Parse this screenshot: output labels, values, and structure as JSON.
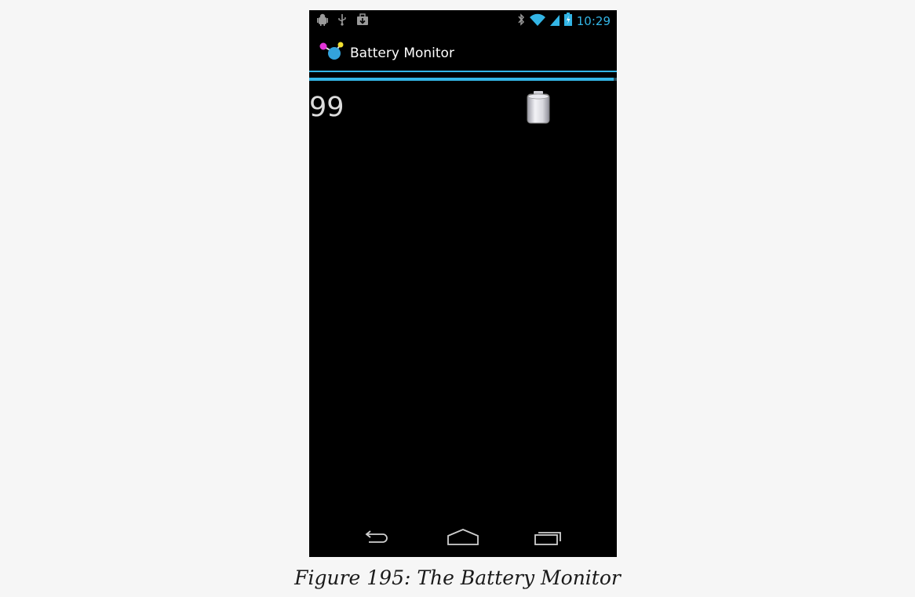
{
  "status_bar": {
    "time": "10:29",
    "left_icons": [
      "android-debug-icon",
      "usb-icon",
      "download-icon"
    ],
    "right_icons": [
      "bluetooth-icon",
      "wifi-icon",
      "signal-icon",
      "battery-charging-icon"
    ],
    "accent_color": "#33b5e5"
  },
  "action_bar": {
    "title": "Battery Monitor",
    "icon": "app-molecule-icon"
  },
  "main": {
    "battery_level": "99",
    "progress_percent": 99,
    "battery_icon": "battery-full-icon"
  },
  "nav_bar": {
    "buttons": [
      "back-icon",
      "home-icon",
      "recent-apps-icon"
    ]
  },
  "caption": "Figure 195: The Battery Monitor"
}
